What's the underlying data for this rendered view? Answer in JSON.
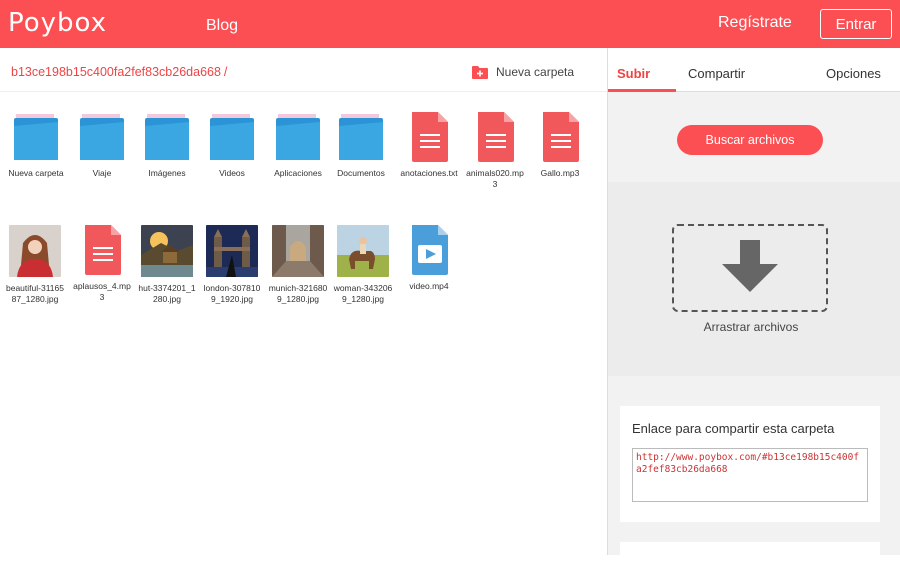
{
  "header": {
    "logo": "Poybox",
    "nav_blog": "Blog",
    "register": "Regístrate",
    "login": "Entrar",
    "accent_color": "#fc4f53"
  },
  "breadcrumb": {
    "path": "b13ce198b15c400fa2fef83cb26da668",
    "separator": "/"
  },
  "toolbar": {
    "new_folder": "Nueva carpeta",
    "new_folder_icon": "folder-plus-icon"
  },
  "files_row1": [
    {
      "label": "Nueva carpeta",
      "type": "folder"
    },
    {
      "label": "Viaje",
      "type": "folder"
    },
    {
      "label": "Imágenes",
      "type": "folder"
    },
    {
      "label": "Videos",
      "type": "folder"
    },
    {
      "label": "Aplicaciones",
      "type": "folder"
    },
    {
      "label": "Documentos",
      "type": "folder"
    },
    {
      "label": "anotaciones.txt",
      "type": "doc"
    },
    {
      "label": "animals020.mp3",
      "type": "doc"
    },
    {
      "label": "Gallo.mp3",
      "type": "doc"
    }
  ],
  "files_row2": [
    {
      "label": "beautiful-3116587_1280.jpg",
      "type": "photo"
    },
    {
      "label": "aplausos_4.mp3",
      "type": "doc"
    },
    {
      "label": "hut-3374201_1280.jpg",
      "type": "photo"
    },
    {
      "label": "london-3078109_1920.jpg",
      "type": "photo"
    },
    {
      "label": "munich-3216809_1280.jpg",
      "type": "photo"
    },
    {
      "label": "woman-3432069_1280.jpg",
      "type": "photo"
    },
    {
      "label": "video.mp4",
      "type": "video"
    }
  ],
  "sidebar": {
    "tabs": [
      "Subir",
      "Compartir",
      "Opciones"
    ],
    "active_tab": "Subir",
    "upload_button": "Buscar archivos",
    "drop_label": "Arrastrar archivos",
    "share_title": "Enlace para compartir esta carpeta",
    "share_link": "http://www.poybox.com/#b13ce198b15c400fa2fef83cb26da668"
  }
}
